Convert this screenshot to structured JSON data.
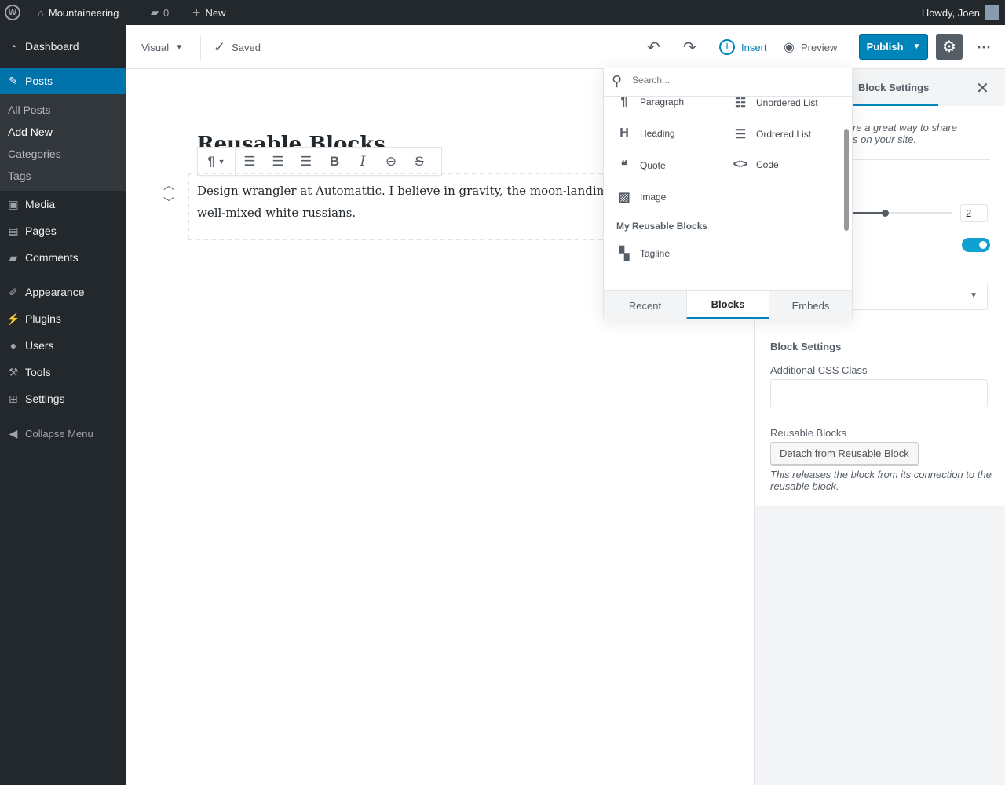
{
  "adminbar": {
    "site": "Mountaineering",
    "comments": "0",
    "new": "New",
    "howdy": "Howdy, Joen"
  },
  "sidebar": {
    "items": [
      {
        "label": "Dashboard",
        "icon": "dashboard-icon"
      },
      {
        "label": "Posts",
        "icon": "pin-icon"
      },
      {
        "label": "Media",
        "icon": "media-icon"
      },
      {
        "label": "Pages",
        "icon": "pages-icon"
      },
      {
        "label": "Comments",
        "icon": "comment-icon"
      },
      {
        "label": "Appearance",
        "icon": "brush-icon"
      },
      {
        "label": "Plugins",
        "icon": "plugin-icon"
      },
      {
        "label": "Users",
        "icon": "user-icon"
      },
      {
        "label": "Tools",
        "icon": "wrench-icon"
      },
      {
        "label": "Settings",
        "icon": "settings-icon"
      }
    ],
    "submenu": [
      "All Posts",
      "Add New",
      "Categories",
      "Tags"
    ],
    "collapse": "Collapse Menu"
  },
  "header": {
    "mode": "Visual",
    "saved": "Saved",
    "insert": "Insert",
    "preview": "Preview",
    "publish": "Publish"
  },
  "editor": {
    "title": "Reusable Blocks",
    "paragraph_line1": "Design wrangler at Automattic. I believe in gravity, the moon-landin",
    "paragraph_line2": "well-mixed white russians."
  },
  "inserter": {
    "search_placeholder": "Search...",
    "blocks": [
      "Paragraph",
      "Unordered List",
      "Heading",
      "Ordrered List",
      "Quote",
      "Code",
      "Image"
    ],
    "reusable_heading": "My Reusable Blocks",
    "reusable": [
      "Tagline"
    ],
    "tabs": [
      "Recent",
      "Blocks",
      "Embeds"
    ],
    "active_tab": "Blocks"
  },
  "panel": {
    "tab": "Block Settings",
    "desc_line1": "re a great way to share",
    "desc_line2": "s on your site.",
    "range_value": "2",
    "toggle_on": true,
    "section": "Block Settings",
    "css_label": "Additional CSS Class",
    "css_value": "",
    "reusable_label": "Reusable Blocks",
    "detach": "Detach from Reusable Block",
    "help": "This releases the block from its connection to the reusable block."
  },
  "colors": {
    "accent": "#0073aa",
    "toggle": "#11a0d2",
    "adminbar": "#23282d"
  }
}
